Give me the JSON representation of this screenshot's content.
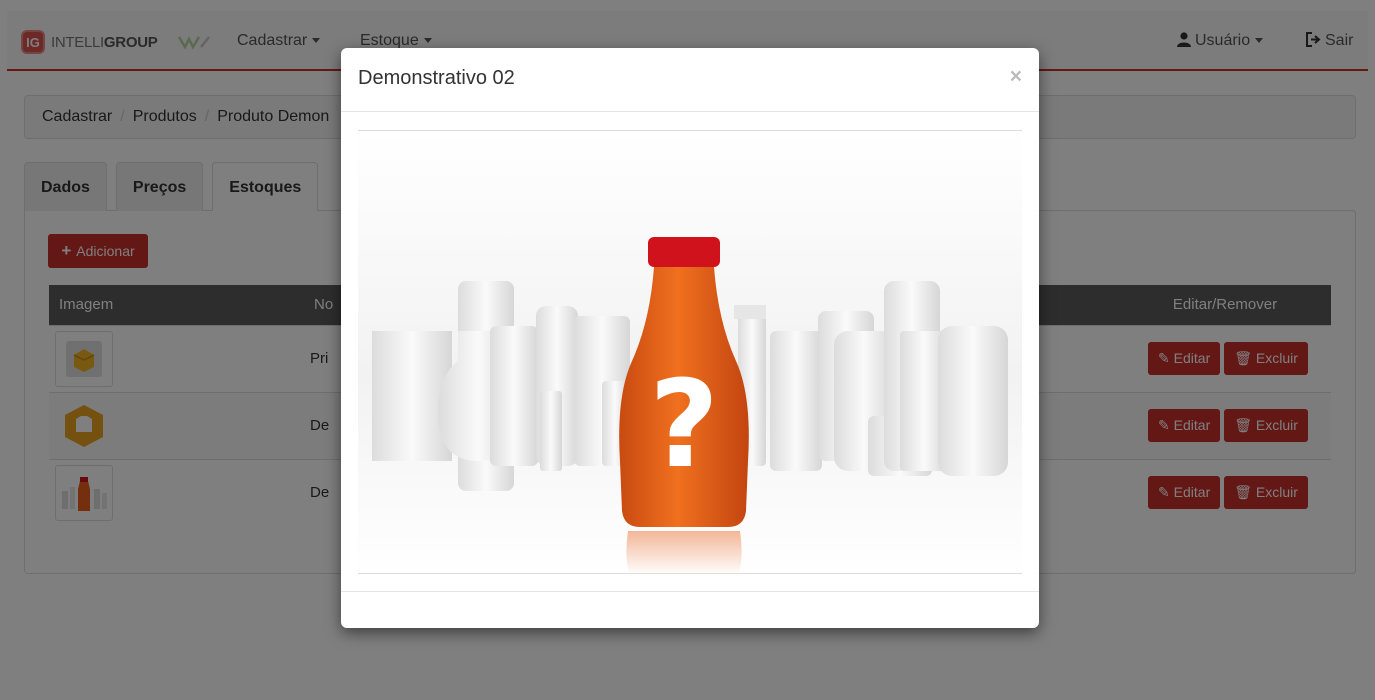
{
  "navbar": {
    "brand_badge": "IG",
    "brand_prefix": "INTELLI",
    "brand_suffix": "GROUP",
    "menu_cadastrar": "Cadastrar",
    "menu_estoque": "Estoque",
    "menu_usuario": "Usuário",
    "menu_sair": "Sair"
  },
  "breadcrumb": {
    "items": [
      "Cadastrar",
      "Produtos",
      "Produto Demon"
    ]
  },
  "tabs": [
    "Dados",
    "Preços",
    "Estoques"
  ],
  "toolbar": {
    "add_label": "Adicionar"
  },
  "table": {
    "headers": {
      "imagem": "Imagem",
      "nome": "No",
      "actions": "Editar/Remover"
    },
    "rows": [
      {
        "name": "Pri",
        "edit": "Editar",
        "delete": "Excluir"
      },
      {
        "name": "De",
        "edit": "Editar",
        "delete": "Excluir"
      },
      {
        "name": "De",
        "edit": "Editar",
        "delete": "Excluir"
      }
    ]
  },
  "modal": {
    "title": "Demonstrativo 02",
    "close": "×",
    "image_alt": "?"
  },
  "colors": {
    "accent": "#c9302c",
    "table_header": "#5a5a5a",
    "bottle": "#e8601c",
    "bottle_cap": "#d0121d"
  }
}
